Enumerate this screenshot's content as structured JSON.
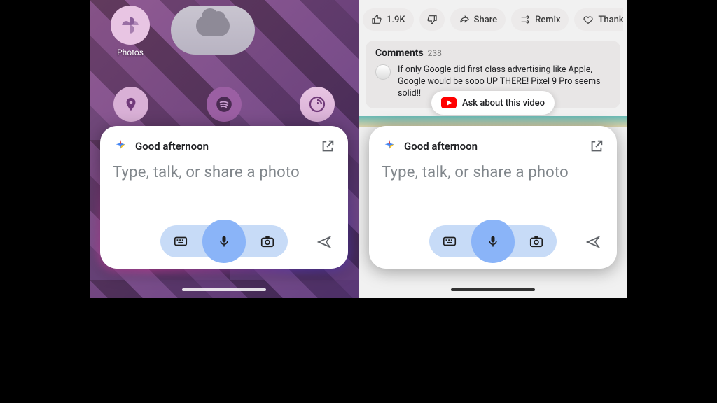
{
  "left": {
    "apps": {
      "photos_label": "Photos"
    },
    "assistant": {
      "greeting": "Good afternoon",
      "placeholder": "Type, talk, or share a photo"
    }
  },
  "right": {
    "actions": {
      "like_count": "1.9K",
      "share": "Share",
      "remix": "Remix",
      "thanks": "Thanks"
    },
    "comments": {
      "title": "Comments",
      "count": "238",
      "top_comment": "If only Google did first class advertising like Apple, Google would be sooo UP THERE! Pixel 9 Pro seems solid!!"
    },
    "ask_chip": "Ask about this video",
    "assistant": {
      "greeting": "Good afternoon",
      "placeholder": "Type, talk, or share a photo"
    }
  }
}
